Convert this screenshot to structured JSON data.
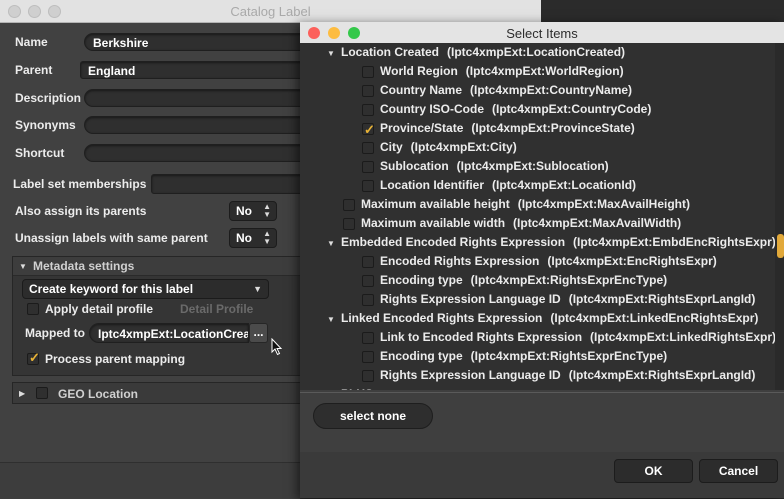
{
  "background_window": {
    "title": "Catalog Label",
    "fields": {
      "name_label": "Name",
      "name_value": "Berkshire",
      "parent_label": "Parent",
      "parent_value": "England",
      "description_label": "Description",
      "synonyms_label": "Synonyms",
      "shortcut_label": "Shortcut",
      "label_set_label": "Label set memberships",
      "assign_parents_label": "Also assign its parents",
      "assign_parents_value": "No",
      "unassign_label": "Unassign labels with same parent",
      "unassign_value": "No"
    },
    "metadata": {
      "header": "Metadata settings",
      "dropdown_value": "Create keyword for this label",
      "apply_detail_label": "Apply detail profile",
      "detail_profile_label": "Detail Profile",
      "mapped_to_label": "Mapped to",
      "mapped_to_value": "Iptc4xmpExt:LocationCrea",
      "ellipsis_label": "...",
      "process_parent_label": "Process parent mapping"
    },
    "geo_label": "GEO Location"
  },
  "dialog": {
    "title": "Select Items",
    "tree": [
      {
        "label": "Location Created",
        "key": "(Iptc4xmpExt:LocationCreated)",
        "level": 0,
        "checkbox": false,
        "expanded": true
      },
      {
        "label": "World Region",
        "key": "(Iptc4xmpExt:WorldRegion)",
        "level": 1,
        "checkbox": true,
        "checked": false
      },
      {
        "label": "Country Name",
        "key": "(Iptc4xmpExt:CountryName)",
        "level": 1,
        "checkbox": true,
        "checked": false
      },
      {
        "label": "Country ISO-Code",
        "key": "(Iptc4xmpExt:CountryCode)",
        "level": 1,
        "checkbox": true,
        "checked": false
      },
      {
        "label": "Province/State",
        "key": "(Iptc4xmpExt:ProvinceState)",
        "level": 1,
        "checkbox": true,
        "checked": true
      },
      {
        "label": "City",
        "key": "(Iptc4xmpExt:City)",
        "level": 1,
        "checkbox": true,
        "checked": false
      },
      {
        "label": "Sublocation",
        "key": "(Iptc4xmpExt:Sublocation)",
        "level": 1,
        "checkbox": true,
        "checked": false
      },
      {
        "label": "Location Identifier",
        "key": "(Iptc4xmpExt:LocationId)",
        "level": 1,
        "checkbox": true,
        "checked": false
      },
      {
        "label": "Maximum available height",
        "key": "(Iptc4xmpExt:MaxAvailHeight)",
        "level": 0,
        "checkbox": true,
        "checked": false
      },
      {
        "label": "Maximum available width",
        "key": "(Iptc4xmpExt:MaxAvailWidth)",
        "level": 0,
        "checkbox": true,
        "checked": false
      },
      {
        "label": "Embedded Encoded Rights Expression",
        "key": "(Iptc4xmpExt:EmbdEncRightsExpr)",
        "level": 0,
        "checkbox": false,
        "expanded": true
      },
      {
        "label": "Encoded Rights Expression",
        "key": "(Iptc4xmpExt:EncRightsExpr)",
        "level": 1,
        "checkbox": true,
        "checked": false
      },
      {
        "label": "Encoding type",
        "key": "(Iptc4xmpExt:RightsExprEncType)",
        "level": 1,
        "checkbox": true,
        "checked": false
      },
      {
        "label": "Rights Expression Language ID",
        "key": "(Iptc4xmpExt:RightsExprLangId)",
        "level": 1,
        "checkbox": true,
        "checked": false
      },
      {
        "label": "Linked Encoded Rights Expression",
        "key": "(Iptc4xmpExt:LinkedEncRightsExpr)",
        "level": 0,
        "checkbox": false,
        "expanded": true
      },
      {
        "label": "Link to Encoded Rights Expression",
        "key": "(Iptc4xmpExt:LinkedRightsExpr)",
        "level": 1,
        "checkbox": true,
        "checked": false
      },
      {
        "label": "Encoding type",
        "key": "(Iptc4xmpExt:RightsExprEncType)",
        "level": 1,
        "checkbox": true,
        "checked": false
      },
      {
        "label": "Rights Expression Language ID",
        "key": "(Iptc4xmpExt:RightsExprLangId)",
        "level": 1,
        "checkbox": true,
        "checked": false
      },
      {
        "label": "PLUS",
        "key": "",
        "level": 0,
        "checkbox": false,
        "expanded": true
      }
    ],
    "select_none_label": "select none",
    "ok_label": "OK",
    "cancel_label": "Cancel"
  },
  "colors": {
    "accent": "#e8b336",
    "close": "#fc605b",
    "minimize": "#fdbc40",
    "zoom": "#34c84a"
  }
}
